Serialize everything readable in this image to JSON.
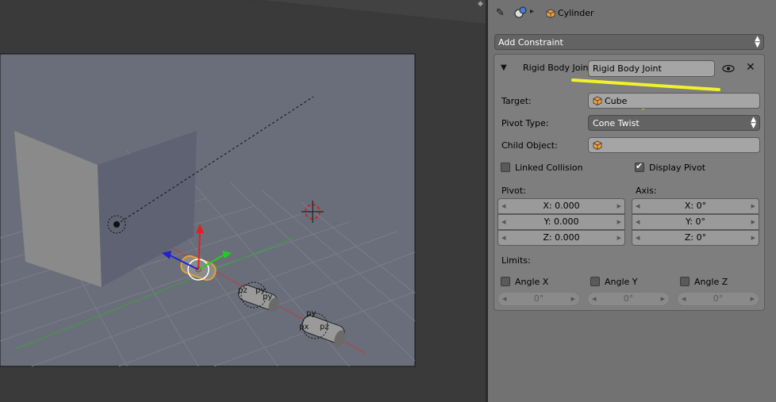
{
  "header": {
    "object_name": "Cylinder"
  },
  "add_constraint_label": "Add Constraint",
  "constraint": {
    "type_label": "Rigid Body Join",
    "name": "Rigid Body Joint",
    "target_label": "Target:",
    "target_value": "Cube",
    "pivot_type_label": "Pivot Type:",
    "pivot_type_value": "Cone Twist",
    "child_object_label": "Child Object:",
    "child_object_value": "",
    "linked_collision_label": "Linked Collision",
    "linked_collision_checked": false,
    "display_pivot_label": "Display Pivot",
    "display_pivot_checked": true,
    "pivot_label": "Pivot:",
    "pivot": [
      "X: 0.000",
      "Y: 0.000",
      "Z: 0.000"
    ],
    "axis_label": "Axis:",
    "axis": [
      "X: 0°",
      "Y: 0°",
      "Z: 0°"
    ],
    "limits_label": "Limits:",
    "limits": [
      {
        "label": "Angle X",
        "value": "0°",
        "checked": false
      },
      {
        "label": "Angle Y",
        "value": "0°",
        "checked": false
      },
      {
        "label": "Angle Z",
        "value": "0°",
        "checked": false
      }
    ]
  },
  "viewport_labels": {
    "obj1": [
      "pz",
      "py",
      "px"
    ],
    "obj2": [
      "py",
      "px",
      "pz"
    ]
  },
  "colors": {
    "panel_bg": "#727272",
    "box_bg": "#7e7e7e",
    "field_bg": "#a5a5a5",
    "select_bg": "#636363",
    "highlight": "#f2f22a",
    "axis_red": "#cc3333",
    "axis_green": "#33aa33",
    "object_orange": "#e8a030"
  }
}
